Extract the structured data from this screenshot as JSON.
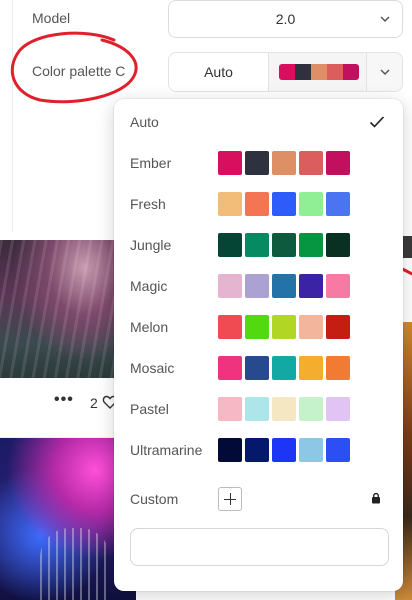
{
  "settings": {
    "model": {
      "label": "Model",
      "value": "2.0"
    },
    "palette": {
      "label": "Color palette C",
      "value": "Auto",
      "preview_colors": [
        "#d80e5f",
        "#2e323e",
        "#de8f65",
        "#db5d5d",
        "#c2105e"
      ]
    }
  },
  "card": {
    "like_count": "2",
    "menu": "•••"
  },
  "dropdown": {
    "options": [
      {
        "label": "Auto",
        "selected": true,
        "colors": []
      },
      {
        "label": "Ember",
        "colors": [
          "#d80e5f",
          "#2e323e",
          "#de8f65",
          "#db5d5d",
          "#c2105e"
        ]
      },
      {
        "label": "Fresh",
        "colors": [
          "#f2bd78",
          "#f37553",
          "#2d5cfb",
          "#90ee95",
          "#4a74f2"
        ]
      },
      {
        "label": "Jungle",
        "colors": [
          "#054535",
          "#058a61",
          "#0d5a3f",
          "#069540",
          "#0a2f23"
        ]
      },
      {
        "label": "Magic",
        "colors": [
          "#e5b5cf",
          "#aca2d1",
          "#2373a8",
          "#3a23a4",
          "#f77aa5"
        ]
      },
      {
        "label": "Melon",
        "colors": [
          "#f04a53",
          "#53d90f",
          "#b1d623",
          "#f3b69d",
          "#c51d13"
        ]
      },
      {
        "label": "Mosaic",
        "colors": [
          "#f0337f",
          "#264a8d",
          "#12a8a4",
          "#f5ad2e",
          "#f27b33"
        ]
      },
      {
        "label": "Pastel",
        "colors": [
          "#f5b8c4",
          "#ade5e8",
          "#f6e7c3",
          "#c6f2cb",
          "#e2c4f4"
        ]
      },
      {
        "label": "Ultramarine",
        "colors": [
          "#020a38",
          "#04196b",
          "#1d35f5",
          "#8ec7e6",
          "#2d4df5"
        ]
      }
    ],
    "custom": {
      "label": "Custom",
      "input_value": ""
    }
  },
  "annotation_color": "#e0202a"
}
